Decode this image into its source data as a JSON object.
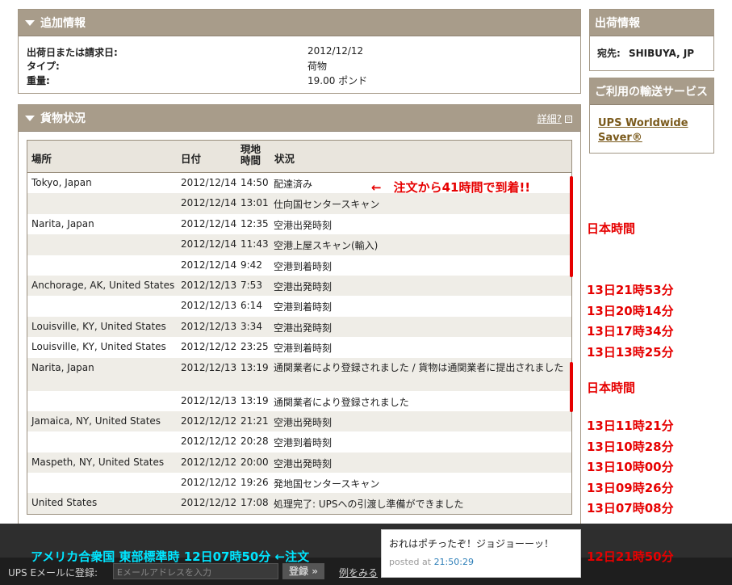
{
  "additional_info": {
    "title": "追加情報",
    "rows": [
      {
        "label": "出荷日または請求日:",
        "value": "2012/12/12"
      },
      {
        "label": "タイプ:",
        "value": "荷物"
      },
      {
        "label": "重量:",
        "value": "19.00 ポンド"
      }
    ]
  },
  "shipping_info": {
    "title": "出荷情報",
    "dest_label": "宛先:",
    "dest_value": "SHIBUYA, JP"
  },
  "service": {
    "title": "ご利用の輸送サービス",
    "link": "UPS Worldwide Saver®"
  },
  "package_status": {
    "title": "貨物状況",
    "detail_link": "詳細?",
    "headers": {
      "location": "場所",
      "date": "日付",
      "local_time": "現地時間",
      "status": "状況"
    },
    "rows": [
      {
        "location": "Tokyo, Japan",
        "date": "2012/12/14",
        "time": "14:50",
        "status": "配達済み"
      },
      {
        "location": "",
        "date": "2012/12/14",
        "time": "13:01",
        "status": "仕向国センタースキャン"
      },
      {
        "location": "Narita, Japan",
        "date": "2012/12/14",
        "time": "12:35",
        "status": "空港出発時刻"
      },
      {
        "location": "",
        "date": "2012/12/14",
        "time": "11:43",
        "status": "空港上屋スキャン(輸入)"
      },
      {
        "location": "",
        "date": "2012/12/14",
        "time": "9:42",
        "status": "空港到着時刻"
      },
      {
        "location": "Anchorage, AK, United States",
        "date": "2012/12/13",
        "time": "7:53",
        "status": "空港出発時刻"
      },
      {
        "location": "",
        "date": "2012/12/13",
        "time": "6:14",
        "status": "空港到着時刻"
      },
      {
        "location": "Louisville, KY, United States",
        "date": "2012/12/13",
        "time": "3:34",
        "status": "空港出発時刻"
      },
      {
        "location": "Louisville, KY, United States",
        "date": "2012/12/12",
        "time": "23:25",
        "status": "空港到着時刻"
      },
      {
        "location": "Narita, Japan",
        "date": "2012/12/13",
        "time": "13:19",
        "status": "通関業者により登録されました / 貨物は通関業者に提出されました"
      },
      {
        "location": "",
        "date": "2012/12/13",
        "time": "13:19",
        "status": "通関業者により登録されました"
      },
      {
        "location": "Jamaica, NY, United States",
        "date": "2012/12/12",
        "time": "21:21",
        "status": "空港出発時刻"
      },
      {
        "location": "",
        "date": "2012/12/12",
        "time": "20:28",
        "status": "空港到着時刻"
      },
      {
        "location": "Maspeth, NY, United States",
        "date": "2012/12/12",
        "time": "20:00",
        "status": "空港出発時刻"
      },
      {
        "location": "",
        "date": "2012/12/12",
        "time": "19:26",
        "status": "発地国センタースキャン"
      },
      {
        "location": "United States",
        "date": "2012/12/12",
        "time": "17:08",
        "status": "処理完了: UPSへの引渡し準備ができました"
      }
    ]
  },
  "annotations": {
    "arrival_note": "←　注文から41時間で到着!!",
    "jp_time_1": "日本時間",
    "jp_time_2": "日本時間",
    "t_anchorage_dep": "13日21時53分",
    "t_anchorage_arr": "13日20時14分",
    "t_louis_dep": "13日17時34分",
    "t_louis_arr": "13日13時25分",
    "t_jamaica_dep": "13日11時21分",
    "t_jamaica_arr": "13日10時28分",
    "t_maspeth_dep": "13日10時00分",
    "t_maspeth_scan": "13日09時26分",
    "t_us_ready": "13日07時08分",
    "t_order": "12日21時50分",
    "est_note": "アメリカ合衆国 東部標準時 12日07時50分 ←注文"
  },
  "tweet": {
    "message": "おれはポチったぞ！ジョジョーーッ！",
    "posted_prefix": "posted at",
    "posted_time": "21:50:29"
  },
  "footer": {
    "email_label": "UPS Eメールに登録:",
    "email_placeholder": "Eメールアドレスを入力",
    "register_button": "登録 »",
    "example_link": "例をみる"
  }
}
